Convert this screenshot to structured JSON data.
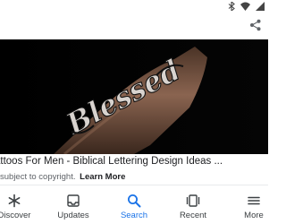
{
  "result": {
    "title": "attoos For Men - Biblical Lettering Design Ideas ...",
    "copyright_text": "subject to copyright.",
    "learn_more": "Learn More",
    "image_text": "Blessed"
  },
  "bottom_nav": {
    "items": [
      {
        "label": "Discover",
        "icon": "asterisk-icon",
        "active": false
      },
      {
        "label": "Updates",
        "icon": "updates-icon",
        "active": false
      },
      {
        "label": "Search",
        "icon": "search-icon",
        "active": true
      },
      {
        "label": "Recent",
        "icon": "recent-tabs-icon",
        "active": false
      },
      {
        "label": "More",
        "icon": "more-icon",
        "active": false
      }
    ]
  },
  "colors": {
    "accent": "#1a73e8",
    "text": "#202124",
    "muted": "#5f6368"
  }
}
